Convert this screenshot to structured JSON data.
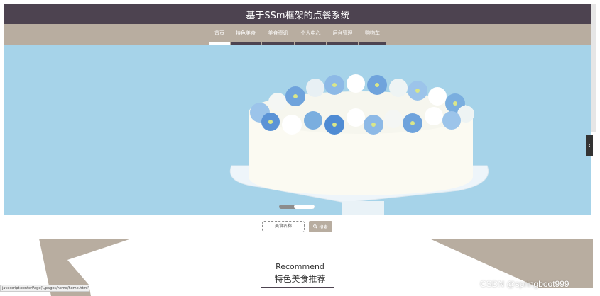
{
  "header": {
    "title": "基于SSm框架的点餐系统"
  },
  "nav": {
    "items": [
      {
        "label": "首页",
        "active": true
      },
      {
        "label": "特色美食",
        "active": false
      },
      {
        "label": "美食资讯",
        "active": false
      },
      {
        "label": "个人中心",
        "active": false
      },
      {
        "label": "后台管理",
        "active": false
      },
      {
        "label": "购物车",
        "active": false
      }
    ]
  },
  "hero": {
    "slide_count": 2,
    "active_slide": 2
  },
  "side_tab": {
    "glyph": "‹"
  },
  "search": {
    "placeholder": "美食名称",
    "button_label": "搜索",
    "icon": "search-icon"
  },
  "recommend": {
    "title_en": "Recommend",
    "title_cn": "特色美食推荐"
  },
  "status_bar": {
    "url": "javascript:centerPage('./pages/home/home.html')"
  },
  "watermark": {
    "text": "CSDN @springboot999"
  },
  "colors": {
    "header_bg": "#4d4350",
    "nav_bg": "#b8ada0",
    "hero_sky": "#a6d3e9",
    "accent": "#b8ada0"
  }
}
